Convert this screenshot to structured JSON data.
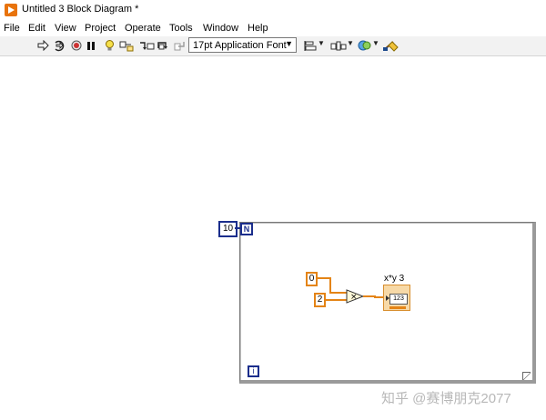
{
  "window": {
    "title": "Untitled 3 Block Diagram *"
  },
  "menu": [
    "File",
    "Edit",
    "View",
    "Project",
    "Operate",
    "Tools",
    "Window",
    "Help"
  ],
  "toolbar": {
    "font_select": "17pt Application Font",
    "icons": [
      "run-arrow-icon",
      "run-continuously-icon",
      "abort-icon",
      "pause-icon",
      "highlight-execution-icon",
      "retain-wire-values-icon",
      "step-into-icon",
      "step-over-icon",
      "step-out-icon",
      "align-objects-icon",
      "distribute-objects-icon",
      "reorder-icon",
      "cleanup-diagram-icon"
    ]
  },
  "diagram": {
    "loop_count_constant": "10",
    "count_terminal": "N",
    "iteration_terminal": "i",
    "constant_a": "0",
    "constant_b": "2",
    "multiply_glyph": "×",
    "indicator_label": "x*y 3",
    "indicator_type": "123"
  },
  "colors": {
    "integer_wire": "#e48416",
    "loop_terminal": "#1b2e8c",
    "app_accent": "#e8730c"
  },
  "watermark": "知乎 @赛博朋克2077"
}
